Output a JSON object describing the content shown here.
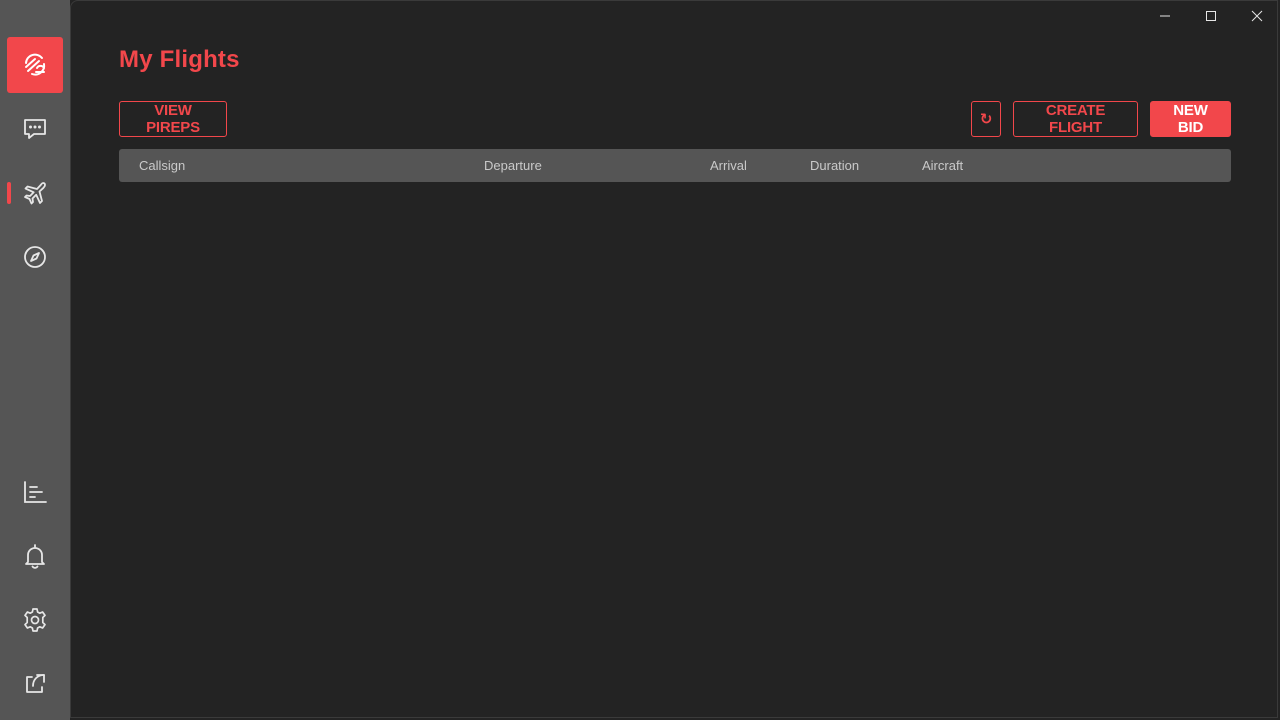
{
  "app": {
    "page_title": "My Flights"
  },
  "sidebar": {
    "items": [
      {
        "id": "logo",
        "icon": "app-logo-icon"
      },
      {
        "id": "chat",
        "icon": "chat-icon"
      },
      {
        "id": "flights",
        "icon": "airplane-icon",
        "active": true
      },
      {
        "id": "explore",
        "icon": "compass-icon"
      },
      {
        "id": "stats",
        "icon": "stats-icon"
      },
      {
        "id": "notifications",
        "icon": "bell-icon"
      },
      {
        "id": "settings",
        "icon": "gear-icon"
      },
      {
        "id": "share",
        "icon": "share-icon"
      }
    ]
  },
  "toolbar": {
    "view_pireps_label": "VIEW PIREPS",
    "refresh_icon": "↻",
    "create_flight_label": "CREATE FLIGHT",
    "new_bid_label": "NEW BID"
  },
  "table": {
    "columns": [
      "Callsign",
      "Departure",
      "Arrival",
      "Duration",
      "Aircraft"
    ],
    "rows": []
  },
  "colors": {
    "accent": "#f2474b",
    "sidebar": "#555555",
    "background": "#232323",
    "header_text": "#c9c9c9"
  }
}
